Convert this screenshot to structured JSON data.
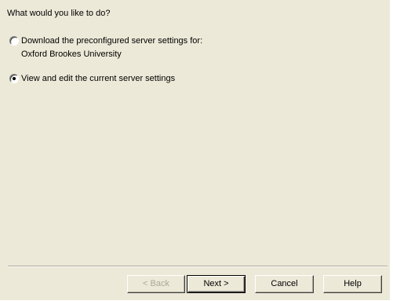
{
  "wizard": {
    "prompt": "What would you like to do?",
    "options": [
      {
        "line1": "Download the preconfigured server settings for:",
        "line2": "Oxford Brookes University",
        "selected": false
      },
      {
        "line1": "View and edit the current server settings",
        "selected": true
      }
    ],
    "buttons": {
      "back": "< Back",
      "next": "Next >",
      "cancel": "Cancel",
      "help": "Help"
    }
  },
  "colors": {
    "dialog_background": "#ece9d8",
    "separator": "#aca899",
    "disabled_text": "#aca899"
  }
}
